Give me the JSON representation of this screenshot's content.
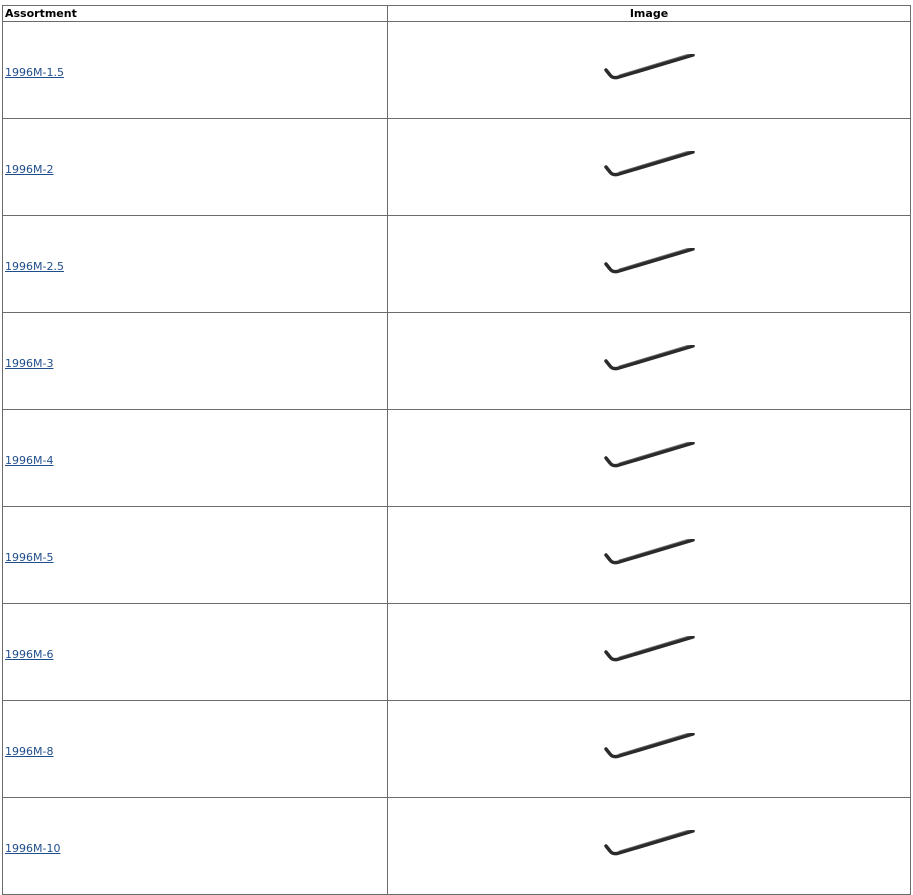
{
  "table": {
    "headers": {
      "assortment": "Assortment",
      "image": "Image"
    },
    "rows": [
      {
        "part": "1996M-1.5",
        "image_icon": "hex-key-icon"
      },
      {
        "part": "1996M-2",
        "image_icon": "hex-key-icon"
      },
      {
        "part": "1996M-2.5",
        "image_icon": "hex-key-icon"
      },
      {
        "part": "1996M-3",
        "image_icon": "hex-key-icon"
      },
      {
        "part": "1996M-4",
        "image_icon": "hex-key-icon"
      },
      {
        "part": "1996M-5",
        "image_icon": "hex-key-icon"
      },
      {
        "part": "1996M-6",
        "image_icon": "hex-key-icon"
      },
      {
        "part": "1996M-8",
        "image_icon": "hex-key-icon"
      },
      {
        "part": "1996M-10",
        "image_icon": "hex-key-icon"
      }
    ]
  },
  "colors": {
    "link": "#1f4e8c",
    "border": "#6b6b6b",
    "wrench": "#2b2b2b"
  }
}
